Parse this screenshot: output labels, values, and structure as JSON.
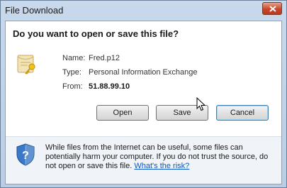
{
  "window": {
    "title": "File Download",
    "close_icon": "close-icon"
  },
  "dialog": {
    "question": "Do you want to open or save this file?",
    "file_icon": "certificate-file-icon",
    "fields": [
      {
        "label": "Name:",
        "value": "Fred.p12"
      },
      {
        "label": "Type:",
        "value": "Personal Information Exchange"
      },
      {
        "label": "From:",
        "value": "51.88.99.10"
      }
    ]
  },
  "buttons": {
    "open": "Open",
    "save": "Save",
    "cancel": "Cancel"
  },
  "warning": {
    "icon": "security-shield-icon",
    "text": "While files from the Internet can be useful, some files can potentially harm your computer. If you do not trust the source, do not open or save this file.",
    "link": "What's the risk?"
  },
  "colors": {
    "link": "#0b57c5",
    "close_button": "#c8462a",
    "default_button_border": "#3c7fb1"
  }
}
